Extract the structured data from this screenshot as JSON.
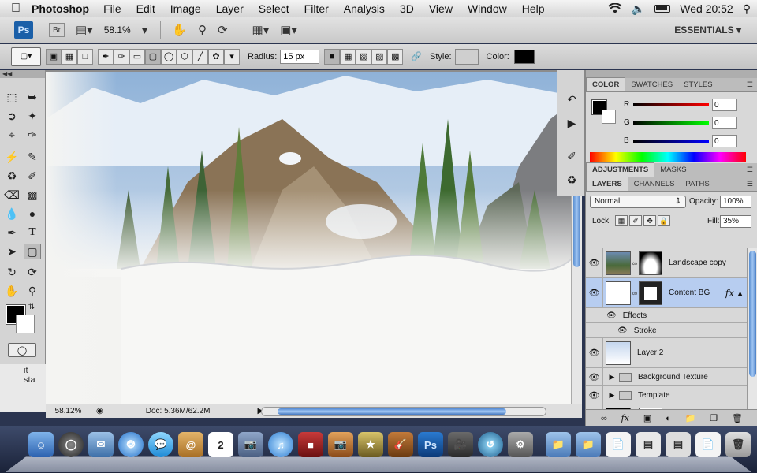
{
  "menubar": {
    "app": "Photoshop",
    "items": [
      "File",
      "Edit",
      "Image",
      "Layer",
      "Select",
      "Filter",
      "Analysis",
      "3D",
      "View",
      "Window",
      "Help"
    ],
    "clock": "Wed 20:52"
  },
  "appbar": {
    "ps_logo": "Ps",
    "br_logo": "Br",
    "zoom": "58.1%",
    "workspace": "ESSENTIALS"
  },
  "options": {
    "radius_label": "Radius:",
    "radius_value": "15 px",
    "style_label": "Style:",
    "color_label": "Color:",
    "color": "#000000"
  },
  "tools": {
    "overflow_text": "it sta"
  },
  "document": {
    "zoom": "58.12%",
    "doc_info": "Doc: 5.36M/62.2M"
  },
  "color_panel": {
    "tabs": [
      "COLOR",
      "SWATCHES",
      "STYLES"
    ],
    "r_label": "R",
    "r_value": "0",
    "g_label": "G",
    "g_value": "0",
    "b_label": "B",
    "b_value": "0"
  },
  "adjustments_panel": {
    "tabs": [
      "ADJUSTMENTS",
      "MASKS"
    ]
  },
  "layers_panel": {
    "tabs": [
      "LAYERS",
      "CHANNELS",
      "PATHS"
    ],
    "blend_mode": "Normal",
    "opacity_label": "Opacity:",
    "opacity": "100%",
    "lock_label": "Lock:",
    "fill_label": "Fill:",
    "fill": "35%",
    "layers": {
      "landscape": "Landscape copy",
      "content_bg": "Content BG",
      "effects": "Effects",
      "stroke": "Stroke",
      "layer2": "Layer 2",
      "bg_texture": "Background Texture",
      "template": "Template"
    }
  }
}
